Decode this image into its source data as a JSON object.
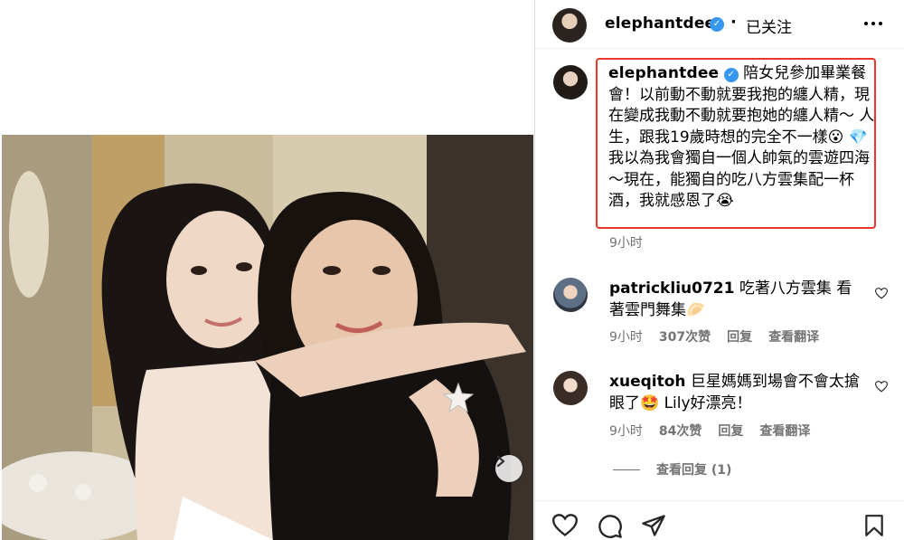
{
  "post": {
    "username": "elephantdee",
    "follow_status": "已关注",
    "caption_username": "elephantdee",
    "caption_text": "陪女兒參加畢業餐會！以前動不動就要我抱的纏人精，現在變成我動不動就要抱她的纏人精～ 人生，跟我19歲時想的完全不一樣😮 💎 我以為我會獨自一個人帥氣的雲遊四海～現在，能獨自的吃八方雲集配一杯酒，我就感恩了😭",
    "caption_time": "9小时"
  },
  "comments": [
    {
      "username": "patrickliu0721",
      "text": "吃著八方雲集 看著雲門舞集🥟",
      "time": "9小时",
      "likes": "307次赞",
      "reply_label": "回复",
      "translate_label": "查看翻译"
    },
    {
      "username": "xueqitoh",
      "text": "巨星媽媽到場會不會太搶眼了🤩 Lily好漂亮！",
      "time": "9小时",
      "likes": "84次赞",
      "reply_label": "回复",
      "translate_label": "查看翻译"
    }
  ],
  "view_replies_label": "查看回复 (1)",
  "colors": {
    "highlight_border": "#e8372c",
    "verified_badge": "#3897f0",
    "meta_text": "#737373"
  },
  "icons": [
    "verified-badge-icon",
    "more-options-icon",
    "carousel-next-icon",
    "heart-icon",
    "comment-icon",
    "share-icon",
    "bookmark-icon"
  ]
}
